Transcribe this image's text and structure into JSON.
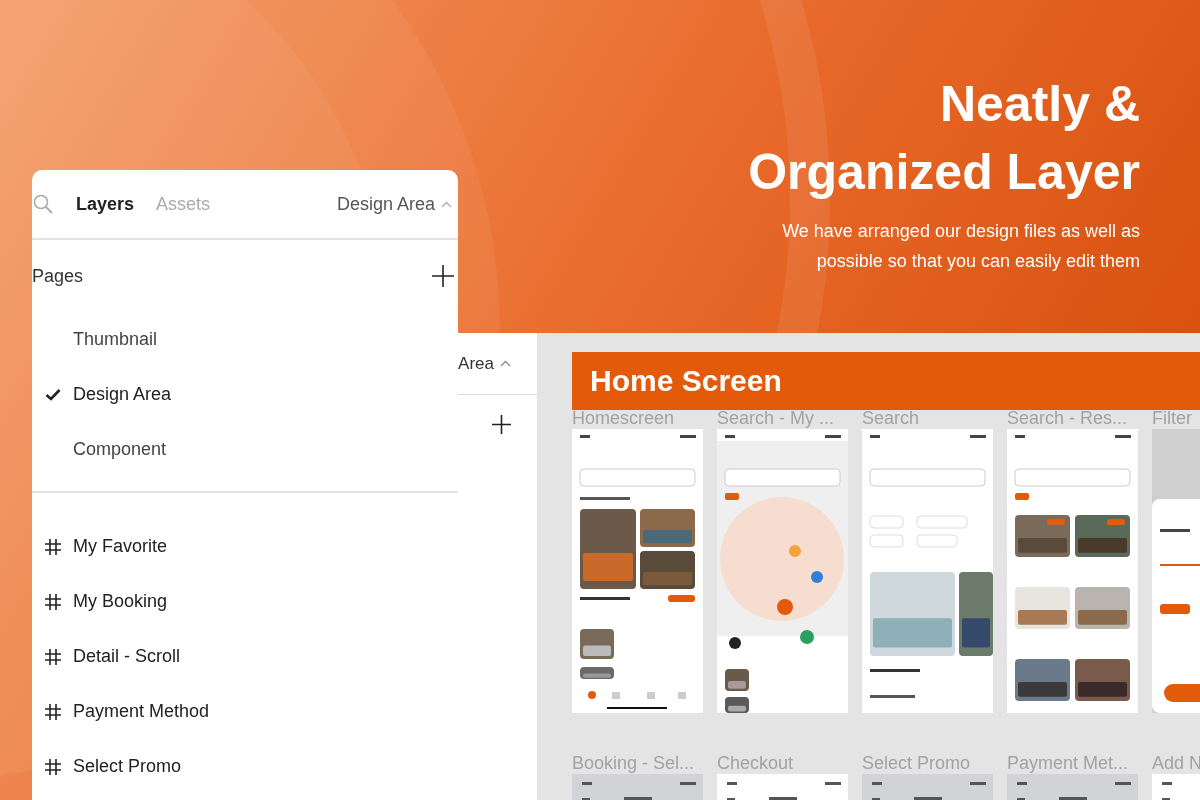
{
  "hero": {
    "title_lines": [
      "Neatly &",
      "Organized Layer"
    ],
    "subtitle_lines": [
      "We have arranged our design files as well as",
      "possible so that you can easily edit them"
    ]
  },
  "back_panel": {
    "page_menu": "Area"
  },
  "canvas": {
    "section_title": "Home Screen",
    "frames": [
      {
        "label": "Homescreen",
        "kind": "home"
      },
      {
        "label": "Search - My ...",
        "kind": "map"
      },
      {
        "label": "Search",
        "kind": "search"
      },
      {
        "label": "Search - Res...",
        "kind": "results"
      },
      {
        "label": "Filter",
        "kind": "filter"
      }
    ],
    "second_row": [
      {
        "label": "Booking - Sel...",
        "dimmed": true
      },
      {
        "label": "Checkout",
        "dimmed": false
      },
      {
        "label": "Select Promo",
        "dimmed": true
      },
      {
        "label": "Payment Met...",
        "dimmed": true
      },
      {
        "label": "Add N",
        "dimmed": false
      }
    ]
  },
  "layers_panel": {
    "tabs": [
      {
        "label": "Layers",
        "selected": true
      },
      {
        "label": "Assets",
        "selected": false
      }
    ],
    "page_menu": "Design Area",
    "pages_heading": "Pages",
    "pages": [
      {
        "label": "Thumbnail",
        "selected": false
      },
      {
        "label": "Design Area",
        "selected": true
      },
      {
        "label": "Component",
        "selected": false
      }
    ],
    "layers": [
      "My Favorite",
      "My Booking",
      "Detail - Scroll",
      "Payment Method",
      "Select Promo"
    ]
  }
}
